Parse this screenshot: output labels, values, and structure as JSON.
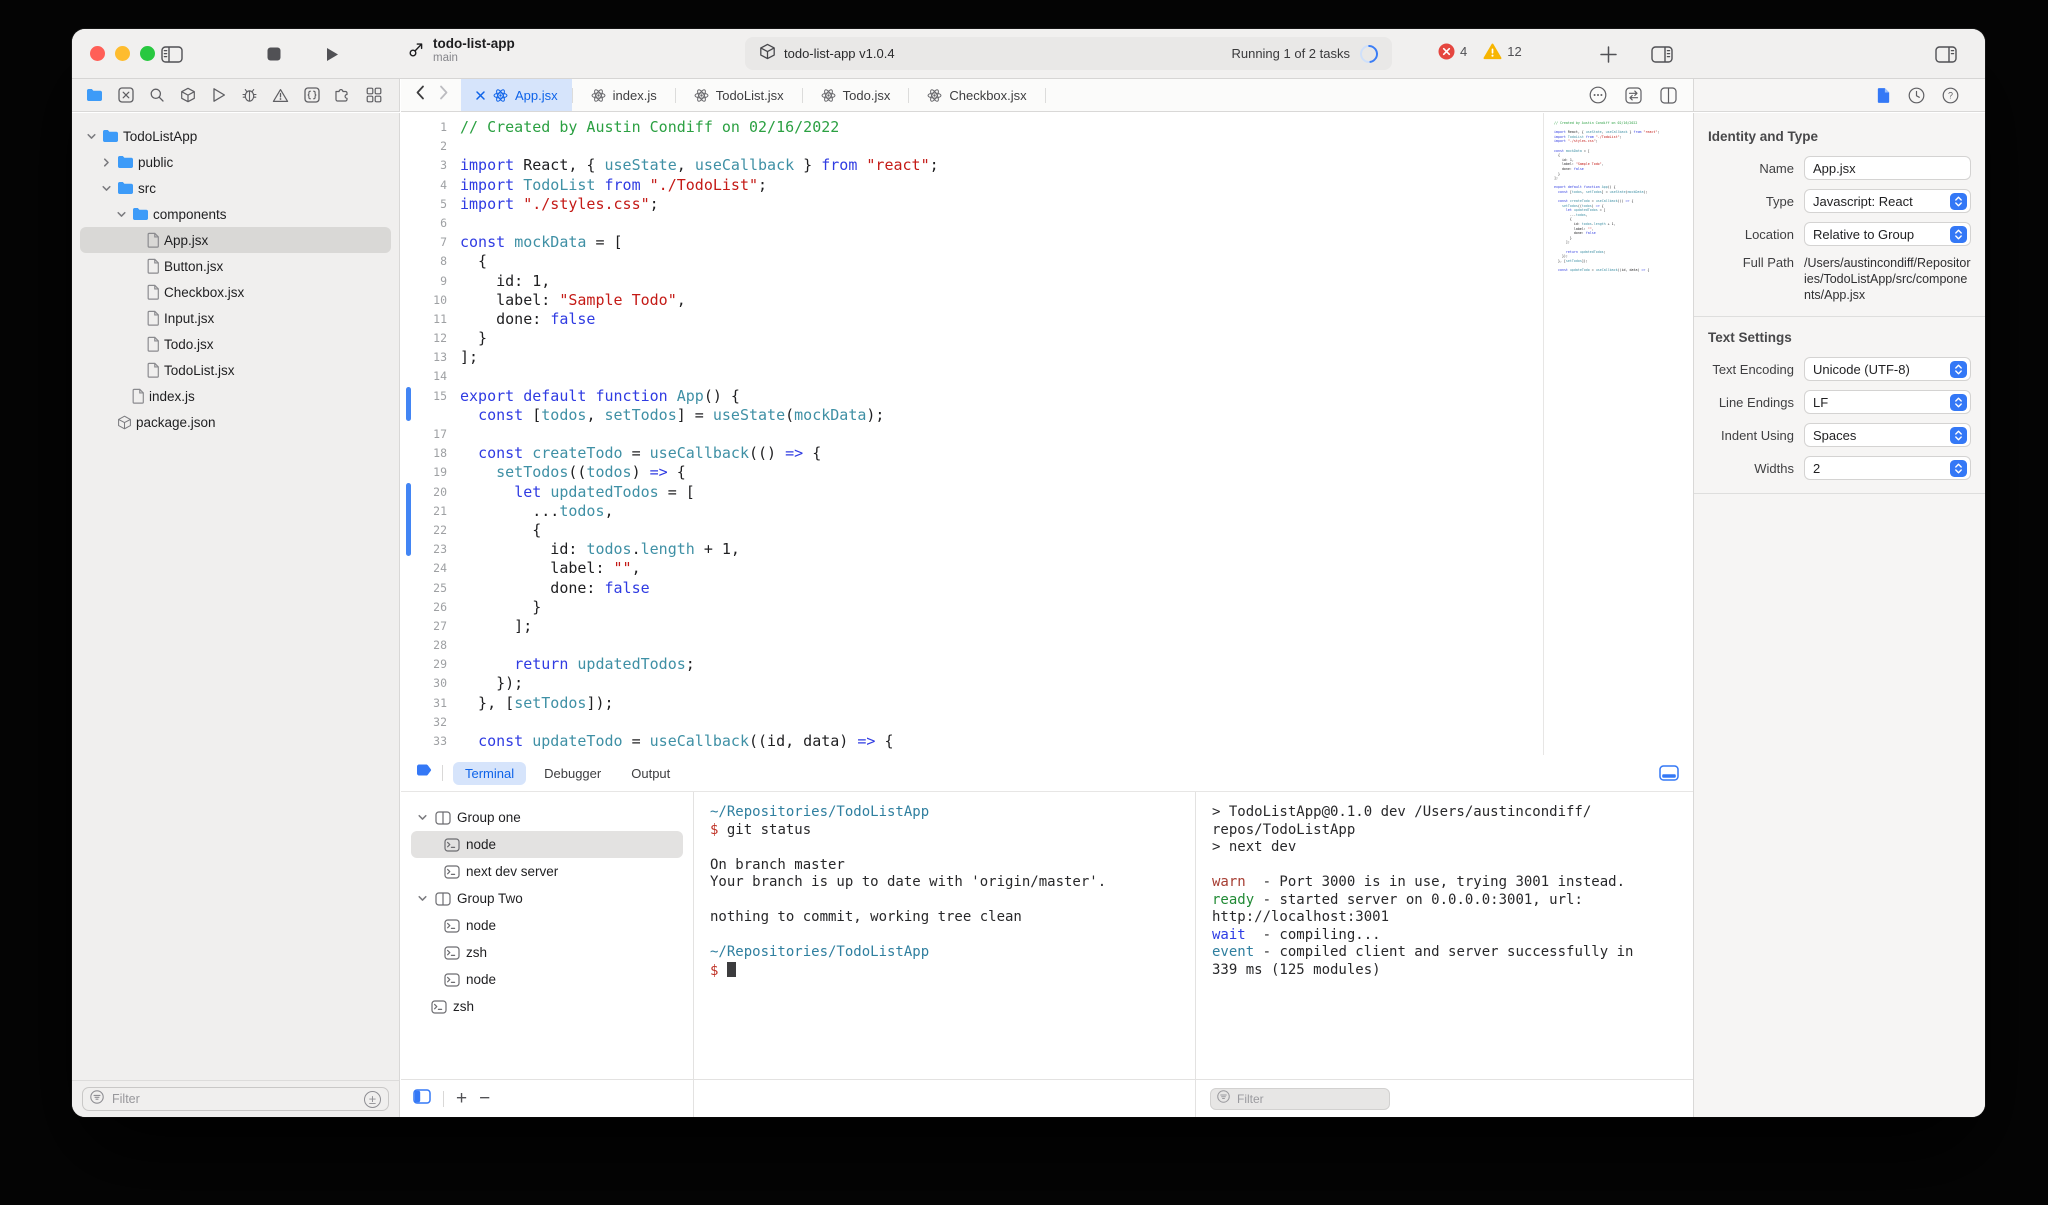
{
  "window": {
    "project": "todo-list-app",
    "branch": "main"
  },
  "toolbar": {
    "scheme": "todo-list-app v1.0.4",
    "status": "Running 1 of 2 tasks",
    "error_count": "4",
    "warning_count": "12"
  },
  "navigator": {
    "strip_icons": [
      "folder",
      "x-square",
      "search",
      "package",
      "play",
      "bug",
      "warning",
      "braces",
      "puzzle",
      "grid"
    ],
    "filter_placeholder": "Filter",
    "tree": [
      {
        "label": "TodoListApp",
        "icon": "folder",
        "depth": 0,
        "chevron": "down"
      },
      {
        "label": "public",
        "icon": "folder",
        "depth": 1,
        "chevron": "right"
      },
      {
        "label": "src",
        "icon": "folder",
        "depth": 1,
        "chevron": "down"
      },
      {
        "label": "components",
        "icon": "folder",
        "depth": 2,
        "chevron": "down"
      },
      {
        "label": "App.jsx",
        "icon": "doc",
        "depth": 3,
        "selected": true
      },
      {
        "label": "Button.jsx",
        "icon": "doc",
        "depth": 3
      },
      {
        "label": "Checkbox.jsx",
        "icon": "doc",
        "depth": 3
      },
      {
        "label": "Input.jsx",
        "icon": "doc",
        "depth": 3
      },
      {
        "label": "Todo.jsx",
        "icon": "doc",
        "depth": 3
      },
      {
        "label": "TodoList.jsx",
        "icon": "doc",
        "depth": 3
      },
      {
        "label": "index.js",
        "icon": "doc",
        "depth": 2
      },
      {
        "label": "package.json",
        "icon": "cube",
        "depth": 1
      }
    ]
  },
  "editor": {
    "tabs": [
      {
        "label": "App.jsx",
        "active": true
      },
      {
        "label": "index.js"
      },
      {
        "label": "TodoList.jsx"
      },
      {
        "label": "Todo.jsx"
      },
      {
        "label": "Checkbox.jsx"
      }
    ],
    "tab_action_icons": [
      "ellipsis",
      "swap",
      "split"
    ],
    "change_bars": [
      {
        "from": 15,
        "to": 16
      },
      {
        "from": 20,
        "to": 23
      }
    ],
    "lines": [
      {
        "n": "1",
        "s": [
          [
            "c",
            "// Created by Austin Condiff on 02/16/2022"
          ]
        ]
      },
      {
        "n": "2",
        "s": []
      },
      {
        "n": "3",
        "s": [
          [
            "k",
            "import"
          ],
          [
            "d",
            " React, { "
          ],
          [
            "i",
            "useState"
          ],
          [
            "d",
            ", "
          ],
          [
            "i",
            "useCallback"
          ],
          [
            "d",
            " } "
          ],
          [
            "k",
            "from"
          ],
          [
            "d",
            " "
          ],
          [
            "s",
            "\"react\""
          ],
          [
            "d",
            ";"
          ]
        ]
      },
      {
        "n": "4",
        "s": [
          [
            "k",
            "import"
          ],
          [
            "d",
            " "
          ],
          [
            "i",
            "TodoList"
          ],
          [
            "d",
            " "
          ],
          [
            "k",
            "from"
          ],
          [
            "d",
            " "
          ],
          [
            "s",
            "\"./TodoList\""
          ],
          [
            "d",
            ";"
          ]
        ]
      },
      {
        "n": "5",
        "s": [
          [
            "k",
            "import"
          ],
          [
            "d",
            " "
          ],
          [
            "s",
            "\"./styles.css\""
          ],
          [
            "d",
            ";"
          ]
        ]
      },
      {
        "n": "6",
        "s": []
      },
      {
        "n": "7",
        "s": [
          [
            "k",
            "const"
          ],
          [
            "d",
            " "
          ],
          [
            "i",
            "mockData"
          ],
          [
            "d",
            " = ["
          ]
        ]
      },
      {
        "n": "8",
        "s": [
          [
            "d",
            "  {"
          ]
        ]
      },
      {
        "n": "9",
        "s": [
          [
            "d",
            "    id: 1,"
          ]
        ]
      },
      {
        "n": "10",
        "s": [
          [
            "d",
            "    label: "
          ],
          [
            "s",
            "\"Sample Todo\""
          ],
          [
            "d",
            ","
          ]
        ]
      },
      {
        "n": "11",
        "s": [
          [
            "d",
            "    done: "
          ],
          [
            "k",
            "false"
          ]
        ]
      },
      {
        "n": "12",
        "s": [
          [
            "d",
            "  }"
          ]
        ]
      },
      {
        "n": "13",
        "s": [
          [
            "d",
            "];"
          ]
        ]
      },
      {
        "n": "14",
        "s": []
      },
      {
        "n": "15",
        "s": [
          [
            "k",
            "export"
          ],
          [
            "d",
            " "
          ],
          [
            "k",
            "default"
          ],
          [
            "d",
            " "
          ],
          [
            "k",
            "function"
          ],
          [
            "d",
            " "
          ],
          [
            "i",
            "App"
          ],
          [
            "d",
            "() {"
          ]
        ]
      },
      {
        "n": "",
        "s": [
          [
            "d",
            "  "
          ],
          [
            "k",
            "const"
          ],
          [
            "d",
            " ["
          ],
          [
            "i",
            "todos"
          ],
          [
            "d",
            ", "
          ],
          [
            "i",
            "setTodos"
          ],
          [
            "d",
            "] = "
          ],
          [
            "i",
            "useState"
          ],
          [
            "d",
            "("
          ],
          [
            "i",
            "mockData"
          ],
          [
            "d",
            ");"
          ]
        ]
      },
      {
        "n": "17",
        "s": []
      },
      {
        "n": "18",
        "s": [
          [
            "d",
            "  "
          ],
          [
            "k",
            "const"
          ],
          [
            "d",
            " "
          ],
          [
            "i",
            "createTodo"
          ],
          [
            "d",
            " = "
          ],
          [
            "i",
            "useCallback"
          ],
          [
            "d",
            "(() "
          ],
          [
            "k",
            "=>"
          ],
          [
            "d",
            " {"
          ]
        ]
      },
      {
        "n": "19",
        "s": [
          [
            "d",
            "    "
          ],
          [
            "i",
            "setTodos"
          ],
          [
            "d",
            "(("
          ],
          [
            "i",
            "todos"
          ],
          [
            "d",
            ") "
          ],
          [
            "k",
            "=>"
          ],
          [
            "d",
            " {"
          ]
        ]
      },
      {
        "n": "20",
        "s": [
          [
            "d",
            "      "
          ],
          [
            "k",
            "let"
          ],
          [
            "d",
            " "
          ],
          [
            "i",
            "updatedTodos"
          ],
          [
            "d",
            " = ["
          ]
        ]
      },
      {
        "n": "21",
        "s": [
          [
            "d",
            "        ..."
          ],
          [
            "i",
            "todos"
          ],
          [
            "d",
            ","
          ]
        ]
      },
      {
        "n": "22",
        "s": [
          [
            "d",
            "        {"
          ]
        ]
      },
      {
        "n": "23",
        "s": [
          [
            "d",
            "          id: "
          ],
          [
            "i",
            "todos"
          ],
          [
            "d",
            "."
          ],
          [
            "i",
            "length"
          ],
          [
            "d",
            " + 1,"
          ]
        ]
      },
      {
        "n": "24",
        "s": [
          [
            "d",
            "          label: "
          ],
          [
            "s",
            "\"\""
          ],
          [
            "d",
            ","
          ]
        ]
      },
      {
        "n": "25",
        "s": [
          [
            "d",
            "          done: "
          ],
          [
            "k",
            "false"
          ]
        ]
      },
      {
        "n": "26",
        "s": [
          [
            "d",
            "        }"
          ]
        ]
      },
      {
        "n": "27",
        "s": [
          [
            "d",
            "      ];"
          ]
        ]
      },
      {
        "n": "28",
        "s": []
      },
      {
        "n": "29",
        "s": [
          [
            "d",
            "      "
          ],
          [
            "k",
            "return"
          ],
          [
            "d",
            " "
          ],
          [
            "i",
            "updatedTodos"
          ],
          [
            "d",
            ";"
          ]
        ]
      },
      {
        "n": "30",
        "s": [
          [
            "d",
            "    });"
          ]
        ]
      },
      {
        "n": "31",
        "s": [
          [
            "d",
            "  }, ["
          ],
          [
            "i",
            "setTodos"
          ],
          [
            "d",
            "]);"
          ]
        ]
      },
      {
        "n": "32",
        "s": []
      },
      {
        "n": "33",
        "s": [
          [
            "d",
            "  "
          ],
          [
            "k",
            "const"
          ],
          [
            "d",
            " "
          ],
          [
            "i",
            "updateTodo"
          ],
          [
            "d",
            " = "
          ],
          [
            "i",
            "useCallback"
          ],
          [
            "d",
            "((id, data) "
          ],
          [
            "k",
            "=>"
          ],
          [
            "d",
            " {"
          ]
        ]
      }
    ]
  },
  "inspector": {
    "strip_icons": [
      "file-blue",
      "clock",
      "help"
    ],
    "sections": [
      {
        "title": "Identity and Type",
        "rows": [
          {
            "label": "Name",
            "control": "input",
            "value": "App.jsx"
          },
          {
            "label": "Type",
            "control": "select",
            "value": "Javascript: React"
          },
          {
            "label": "Location",
            "control": "select",
            "value": "Relative to Group"
          },
          {
            "label": "Full Path",
            "control": "text",
            "value": "/Users/austincondiff/Repositories/TodoListApp/src/components/App.jsx"
          }
        ]
      },
      {
        "title": "Text Settings",
        "rows": [
          {
            "label": "Text Encoding",
            "control": "select",
            "value": "Unicode (UTF-8)"
          },
          {
            "label": "Line Endings",
            "control": "select",
            "value": "LF"
          },
          {
            "label": "Indent Using",
            "control": "select",
            "value": "Spaces"
          },
          {
            "label": "Widths",
            "control": "select",
            "value": "2"
          }
        ]
      }
    ]
  },
  "panel": {
    "tabs": [
      {
        "label": "Terminal",
        "active": true
      },
      {
        "label": "Debugger"
      },
      {
        "label": "Output"
      }
    ],
    "filter_placeholder": "Filter",
    "sessions": [
      {
        "kind": "group",
        "label": "Group one"
      },
      {
        "kind": "term",
        "label": "node",
        "selected": true
      },
      {
        "kind": "term",
        "label": "next dev server"
      },
      {
        "kind": "group",
        "label": "Group Two"
      },
      {
        "kind": "term",
        "label": "node"
      },
      {
        "kind": "term",
        "label": "zsh"
      },
      {
        "kind": "term",
        "label": "node"
      },
      {
        "kind": "term",
        "label": "zsh",
        "root": true
      }
    ],
    "terminal_left": [
      [
        [
          "p",
          "~/Repositories/TodoListApp"
        ]
      ],
      [
        [
          "r",
          "$"
        ],
        [
          "d",
          " git status"
        ]
      ],
      [],
      [
        [
          "d",
          "On branch master"
        ]
      ],
      [
        [
          "d",
          "Your branch is up to date with 'origin/master'."
        ]
      ],
      [],
      [
        [
          "d",
          "nothing to commit, working tree clean"
        ]
      ],
      [],
      [
        [
          "p",
          "~/Repositories/TodoListApp"
        ]
      ],
      [
        [
          "r",
          "$ "
        ],
        [
          "cursor",
          ""
        ]
      ]
    ],
    "terminal_right": [
      [
        [
          "d",
          "> TodoListApp@0.1.0 dev /Users/austincondiff/"
        ]
      ],
      [
        [
          "d",
          "repos/TodoListApp"
        ]
      ],
      [
        [
          "d",
          "> next dev"
        ]
      ],
      [],
      [
        [
          "w",
          "warn"
        ],
        [
          "d",
          "  - Port 3000 is in use, trying 3001 instead."
        ]
      ],
      [
        [
          "g",
          "ready"
        ],
        [
          "d",
          " - started server on 0.0.0.0:3001, url:"
        ]
      ],
      [
        [
          "d",
          "http://localhost:3001"
        ]
      ],
      [
        [
          "b",
          "wait"
        ],
        [
          "d",
          "  - compiling..."
        ]
      ],
      [
        [
          "t",
          "event"
        ],
        [
          "d",
          " - compiled client and server successfully in"
        ]
      ],
      [
        [
          "d",
          "339 ms (125 modules)"
        ]
      ]
    ]
  },
  "colors": {
    "accent": "#3478f6",
    "active_tab_bg": "#d6e4fb",
    "active_tab_text": "#0e63e9",
    "error": "#e5463f",
    "warning": "#f7b500",
    "traffic_red": "#ff5f57",
    "traffic_yellow": "#febc2e",
    "traffic_green": "#28c840"
  }
}
